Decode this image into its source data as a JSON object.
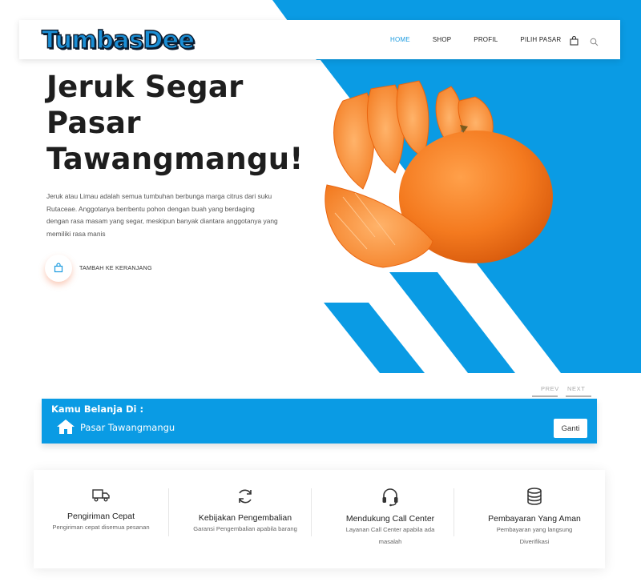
{
  "brand": {
    "logo_text": "TumbasDee"
  },
  "nav": {
    "items": [
      {
        "label": "HOME",
        "active": true
      },
      {
        "label": "SHOP",
        "active": false
      },
      {
        "label": "PROFIL",
        "active": false
      },
      {
        "label": "PILIH PASAR",
        "active": false
      }
    ],
    "icons": [
      "cart-icon",
      "search-icon"
    ]
  },
  "hero": {
    "title_line1": "Jeruk Segar",
    "title_line2": "Pasar",
    "title_line3": "Tawangmangu!",
    "description": "Jeruk atau Limau adalah semua tumbuhan berbunga marga citrus dari suku Rutaceae. Anggotanya berrbentu pohon dengan buah yang berdaging dengan rasa masam yang segar, meskipun banyak diantara anggotanya yang memiliki rasa manis",
    "cart_button_label": "TAMBAH KE KERANJANG"
  },
  "slider": {
    "prev_label": "PREV",
    "next_label": "NEXT"
  },
  "market": {
    "heading": "Kamu Belanja Di :",
    "name": "Pasar Tawangmangu",
    "change_button_label": "Ganti"
  },
  "features": [
    {
      "icon": "truck-icon",
      "title": "Pengiriman Cepat",
      "subtitle": "Pengiriman cepat disemua pesanan"
    },
    {
      "icon": "refresh-icon",
      "title": "Kebijakan Pengembalian",
      "subtitle": "Garansi Pengembalian apabila barang"
    },
    {
      "icon": "headset-icon",
      "title": "Mendukung Call Center",
      "subtitle": "Layanan Call Center apabila ada masalah"
    },
    {
      "icon": "database-icon",
      "title": "Pembayaran Yang Aman",
      "subtitle": "Pembayaran yang langsung Diverifikasi"
    }
  ],
  "colors": {
    "accent_blue": "#0a9be4",
    "nav_active": "#1b9be0",
    "orange": "#f47a1f"
  }
}
